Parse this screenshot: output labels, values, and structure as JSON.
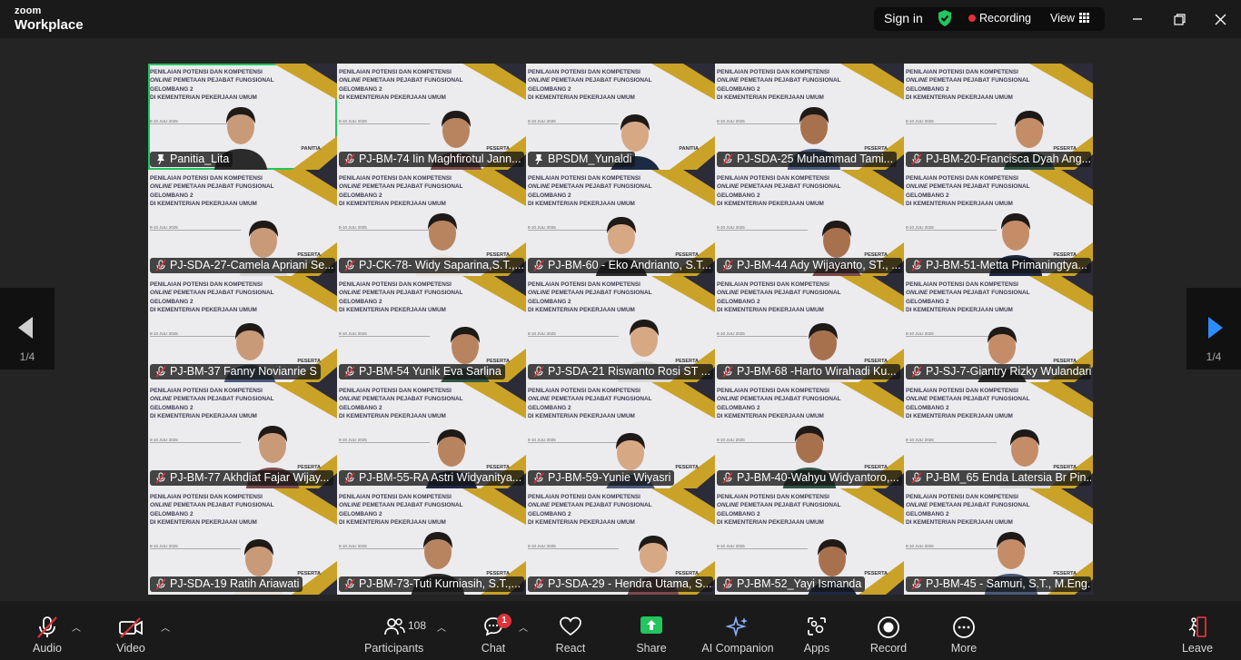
{
  "app": {
    "brand_top": "zoom",
    "brand_bottom": "Workplace"
  },
  "header": {
    "sign_in": "Sign in",
    "recording": "Recording",
    "view": "View",
    "colors": {
      "secure": "#22c55e",
      "recording_dot": "#e0323a"
    }
  },
  "slide": {
    "line1": "PENILAIAN POTENSI DAN KOMPETENSI",
    "line2_italic": "ONLINE",
    "line2_rest": " PEMETAAN PEJABAT FUNGSIONAL",
    "line3": "GELOMBANG 2",
    "line4": "DI KEMENTERIAN PEKERJAAN UMUM",
    "date": "8-10 JULI 2025"
  },
  "participants_grid": [
    {
      "name": "Panitia_Lita",
      "badge": "PANITIA",
      "muted": false,
      "active": true,
      "icon": "pin-icon"
    },
    {
      "name": "PJ-BM-74 Iin Maghfirotul Jann...",
      "badge": "PESERTA",
      "muted": true
    },
    {
      "name": "BPSDM_Yunaldi",
      "badge": "PANITIA",
      "muted": false
    },
    {
      "name": "PJ-SDA-25 Muhammad Tami...",
      "badge": "PESERTA",
      "muted": true
    },
    {
      "name": "PJ-BM-20-Francisca Dyah Ang...",
      "badge": "PESERTA",
      "muted": true
    },
    {
      "name": "PJ-SDA-27-Camela Apriani Se...",
      "badge": "PESERTA",
      "muted": true
    },
    {
      "name": "PJ-CK-78- Widy Saparina,S.T.,...",
      "badge": "PESERTA",
      "muted": true
    },
    {
      "name": "PJ-BM-60 - Eko Andrianto, S.T...",
      "badge": "PESERTA",
      "muted": true
    },
    {
      "name": "PJ-BM-44 Ady Wijayanto, ST., ...",
      "badge": "PESERTA",
      "muted": true
    },
    {
      "name": "PJ-BM-51-Metta Primaningtya...",
      "badge": "PESERTA",
      "muted": true
    },
    {
      "name": "PJ-BM-37 Fanny Novianrie S",
      "badge": "PESERTA",
      "muted": true
    },
    {
      "name": "PJ-BM-54 Yunik Eva Sarlina",
      "badge": "PESERTA",
      "muted": true
    },
    {
      "name": "PJ-SDA-21 Riswanto Rosi ST ...",
      "badge": "PESERTA",
      "muted": true
    },
    {
      "name": "PJ-BM-68 -Harto Wirahadi Ku...",
      "badge": "PESERTA",
      "muted": true
    },
    {
      "name": "PJ-SJ-7-Giantry Rizky Wulandari",
      "badge": "PESERTA",
      "muted": true
    },
    {
      "name": "PJ-BM-77 Akhdiat Fajar Wijay...",
      "badge": "PESERTA",
      "muted": true
    },
    {
      "name": "PJ-BM-55-RA Astri Widyanitya...",
      "badge": "PESERTA",
      "muted": true
    },
    {
      "name": "PJ-BM-59-Yunie Wiyasri",
      "badge": "PESERTA",
      "muted": true
    },
    {
      "name": "PJ-BM-40-Wahyu Widyantoro,...",
      "badge": "PESERTA",
      "muted": true
    },
    {
      "name": "PJ-BM_65 Enda Latersia Br Pin...",
      "badge": "PESERTA",
      "muted": true
    },
    {
      "name": "PJ-SDA-19 Ratih Ariawati",
      "badge": "PESERTA",
      "muted": true
    },
    {
      "name": "PJ-BM-73-Tuti Kurniasih, S.T.,...",
      "badge": "PESERTA",
      "muted": true
    },
    {
      "name": "PJ-SDA-29 - Hendra Utama, S....",
      "badge": "PESERTA",
      "muted": true
    },
    {
      "name": "PJ-BM-52_Yayi Ismanda",
      "badge": "PESERTA",
      "muted": true
    },
    {
      "name": "PJ-BM-45 - Samuri, S.T., M.Eng.",
      "badge": "PESERTA",
      "muted": true
    }
  ],
  "pager": {
    "left_label": "1/4",
    "right_label": "1/4"
  },
  "toolbar": {
    "audio": "Audio",
    "video": "Video",
    "participants": "Participants",
    "participants_count": "108",
    "chat": "Chat",
    "chat_badge": "1",
    "react": "React",
    "share": "Share",
    "ai_companion": "AI Companion",
    "apps": "Apps",
    "record": "Record",
    "more": "More",
    "leave": "Leave",
    "colors": {
      "share": "#22c55e",
      "muted": "#e0323a",
      "leave": "#e0323a"
    }
  }
}
